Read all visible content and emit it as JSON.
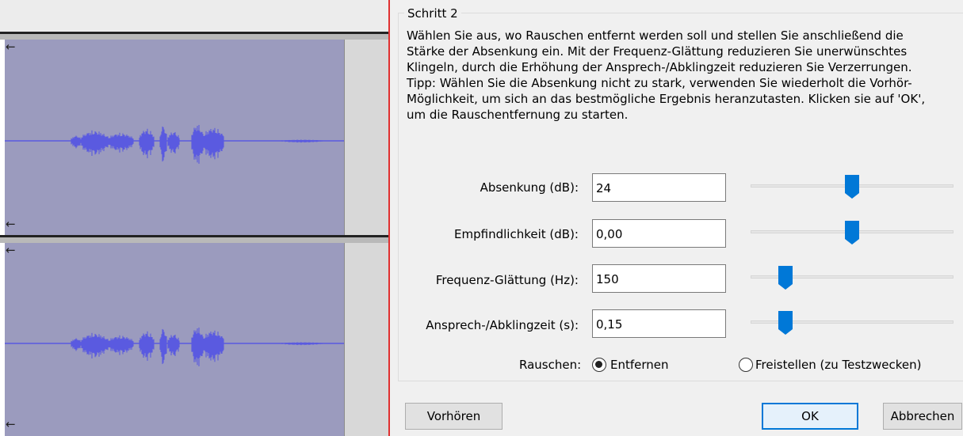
{
  "tracks": {
    "arrow_glyph": "←",
    "waveform_color": "#5a5ae0",
    "track_color": "#9b9bbe"
  },
  "dialog": {
    "group_title": "Schritt 2",
    "help_text": "Wählen Sie aus, wo Rauschen entfernt werden soll und stellen Sie anschließend die\nStärke der Absenkung ein. Mit der Frequenz-Glättung reduzieren Sie unerwünschtes\nKlingeln, durch die Erhöhung der Ansprech-/Abklingzeit reduzieren Sie Verzerrungen.\nTipp: Wählen Sie die Absenkung nicht zu stark, verwenden Sie wiederholt die Vorhör-\nMöglichkeit, um sich an das bestmögliche Ergebnis heranzutasten. Klicken sie auf 'OK',\num die Rauschentfernung zu starten.",
    "params": [
      {
        "label": "Absenkung (dB):",
        "value": "24",
        "slider": 0.5
      },
      {
        "label": "Empfindlichkeit (dB):",
        "value": "0,00",
        "slider": 0.5
      },
      {
        "label": "Frequenz-Glättung (Hz):",
        "value": "150",
        "slider": 0.17
      },
      {
        "label": "Ansprech-/Abklingzeit (s):",
        "value": "0,15",
        "slider": 0.17
      }
    ],
    "noise": {
      "label": "Rauschen:",
      "option_remove": "Entfernen",
      "option_isolate": "Freistellen (zu Testzwecken)",
      "selected": "Entfernen"
    },
    "buttons": {
      "preview": "Vorhören",
      "ok": "OK",
      "cancel": "Abbrechen"
    },
    "accent_color": "#0078d7"
  }
}
